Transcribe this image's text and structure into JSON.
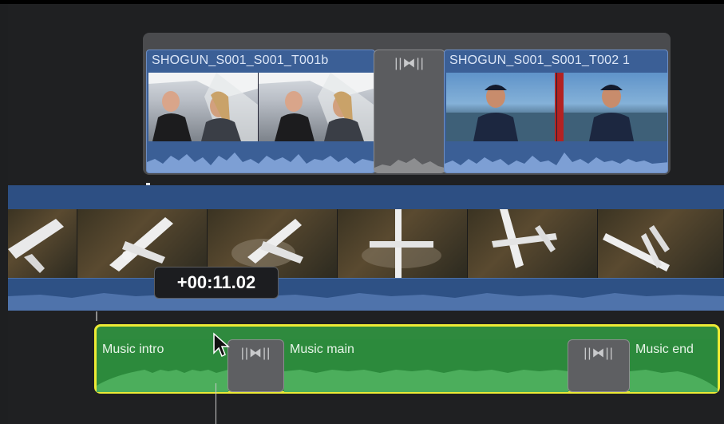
{
  "timeline": {
    "timecode": "+00:11.02",
    "connected_clips": [
      {
        "title": "SHOGUN_S001_S001_T001b"
      },
      {
        "title": "SHOGUN_S001_S001_T002 1"
      }
    ],
    "transition_icon": "||⧓||",
    "audio_clips": [
      {
        "label": "Music intro"
      },
      {
        "label": "Music main"
      },
      {
        "label": "Music end"
      }
    ]
  },
  "colors": {
    "video_clip": "#3b5f96",
    "audio_clip": "#2c8a3c",
    "selection": "#ecea35",
    "transition": "#5b5c5f"
  },
  "icons": [
    "transition-icon",
    "pointer-cursor-icon"
  ]
}
